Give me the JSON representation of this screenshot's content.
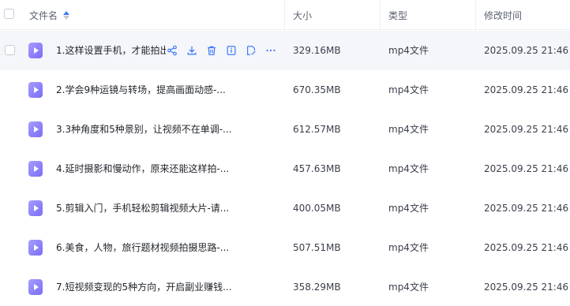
{
  "header": {
    "name_col": "文件名",
    "size_col": "大小",
    "type_col": "类型",
    "time_col": "修改时间"
  },
  "hover_actions": [
    "share-icon",
    "download-icon",
    "delete-icon",
    "details-icon",
    "edit-icon",
    "more-icon"
  ],
  "rows": [
    {
      "name": "1.这样设置手机，才能拍出",
      "size": "329.16MB",
      "type": "mp4文件",
      "time": "2025.09.25 21:46"
    },
    {
      "name": "2.学会9种运镜与转场，提高画面动感-...",
      "size": "670.35MB",
      "type": "mp4文件",
      "time": "2025.09.25 21:46"
    },
    {
      "name": "3.3种角度和5种景别，让视频不在单调-...",
      "size": "612.57MB",
      "type": "mp4文件",
      "time": "2025.09.25 21:46"
    },
    {
      "name": "4.延时摄影和慢动作，原来还能这样拍-...",
      "size": "457.63MB",
      "type": "mp4文件",
      "time": "2025.09.25 21:46"
    },
    {
      "name": "5.剪辑入门，手机轻松剪辑视频大片-请...",
      "size": "400.05MB",
      "type": "mp4文件",
      "time": "2025.09.25 21:46"
    },
    {
      "name": "6.美食，人物，旅行题材视频拍摄思路-...",
      "size": "507.51MB",
      "type": "mp4文件",
      "time": "2025.09.25 21:46"
    },
    {
      "name": "7.短视频变现的5种方向，开启副业赚钱...",
      "size": "358.29MB",
      "type": "mp4文件",
      "time": "2025.09.25 21:46"
    }
  ]
}
